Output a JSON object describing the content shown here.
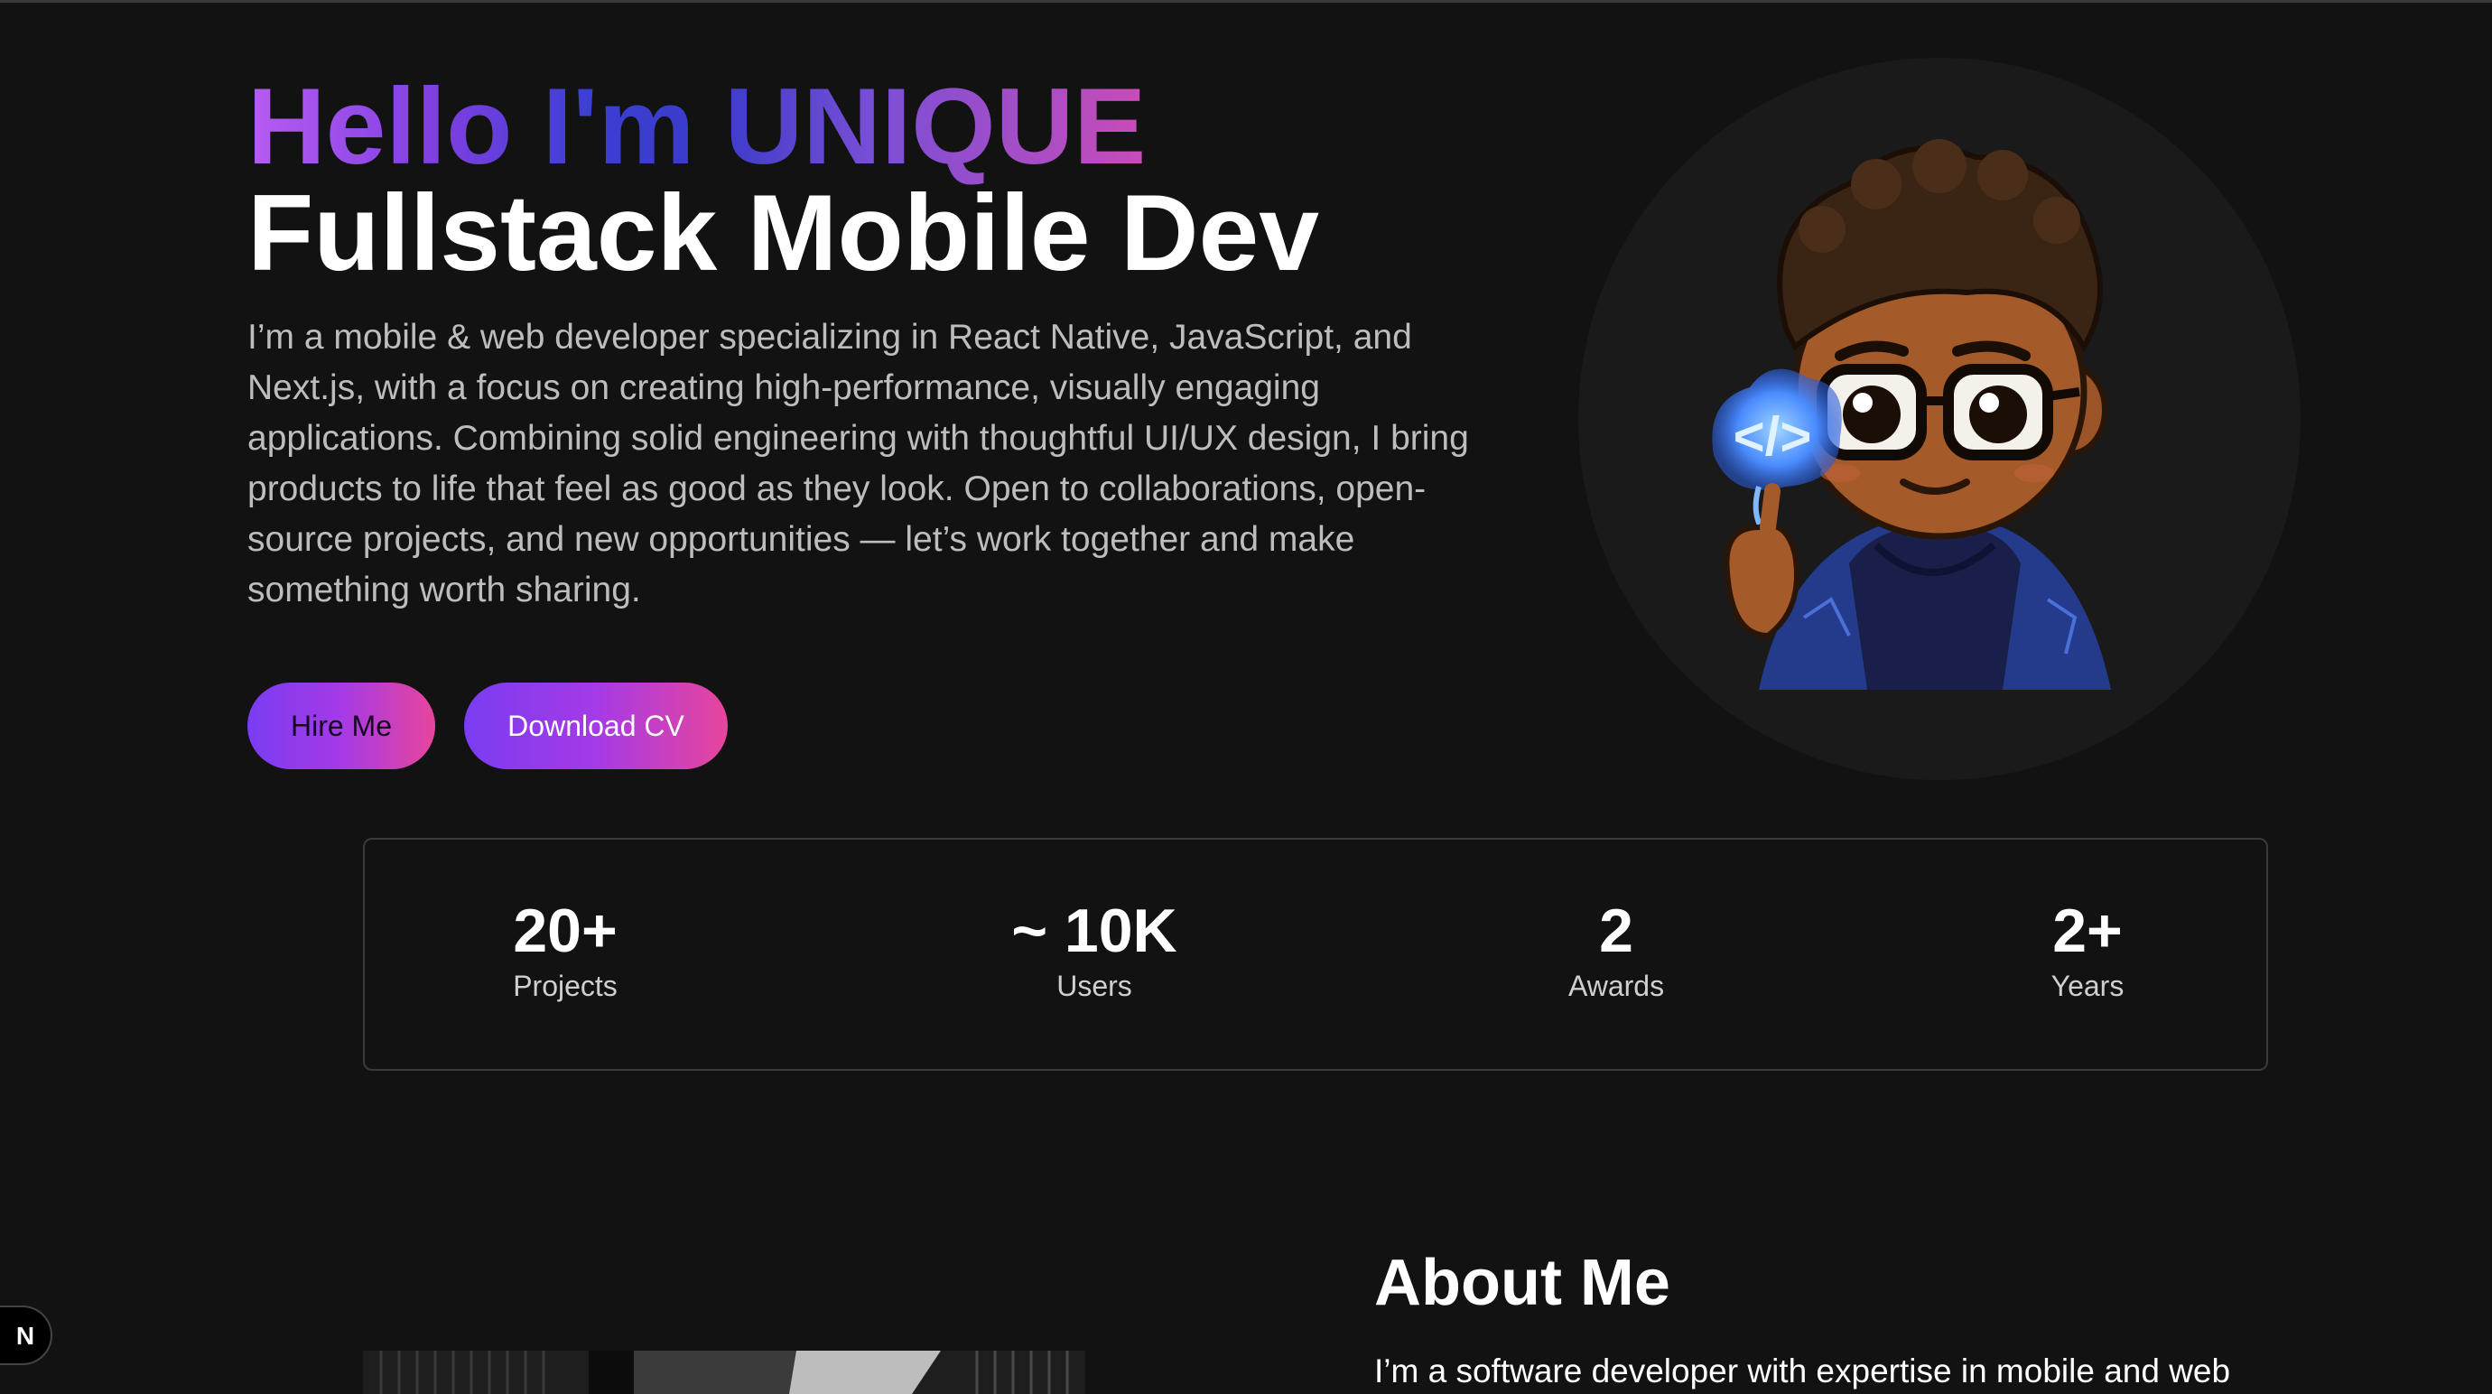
{
  "hero": {
    "greeting": "Hello I'm UNIQUE",
    "role": "Fullstack Mobile Dev",
    "description": "I’m a mobile & web developer specializing in React Native, JavaScript, and Next.js, with a focus on creating high-performance, visually engaging applications. Combining solid engineering with thoughtful UI/UX design, I bring products to life that feel as good as they look. Open to collaborations, open-source projects, and new opportunities — let’s work together and make something worth sharing.",
    "buttons": {
      "hire_label": "Hire Me",
      "cv_label": "Download CV"
    },
    "avatar_icon": "developer-avatar-illustration",
    "code_symbol": "</>"
  },
  "stats": [
    {
      "value": "20+",
      "label": "Projects"
    },
    {
      "value": "~ 10K",
      "label": "Users"
    },
    {
      "value": "2",
      "label": "Awards"
    },
    {
      "value": "2+",
      "label": "Years"
    }
  ],
  "about": {
    "title": "About Me",
    "text_start": "I’m a software developer with expertise in mobile and web"
  },
  "dev_badge": {
    "letter": "N",
    "icon": "nextjs-icon"
  },
  "colors": {
    "background": "#121212",
    "accent_purple": "#7a3cf2",
    "accent_pink": "#e8459c",
    "text_muted": "#bdbdbd"
  }
}
